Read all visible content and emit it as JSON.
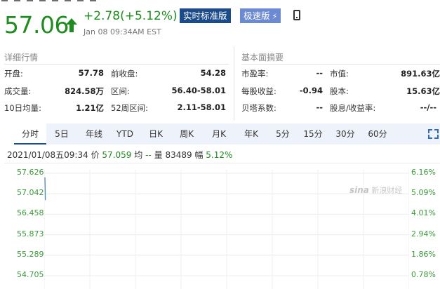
{
  "quote": {
    "price": "57.06",
    "change": "+2.78(+5.12%)",
    "timestamp": "Jan 08 09:34AM EST",
    "realtime_button": "实时标准版",
    "fast_button": "极速版",
    "fast_icon": "bolt-icon",
    "mobile_icon": "phone-icon",
    "up_color": "#1e8c1e"
  },
  "details": {
    "title": "详细行情",
    "rows": [
      [
        {
          "label": "开盘:",
          "value": "57.78"
        },
        {
          "label": "前收盘:",
          "value": "54.28"
        }
      ],
      [
        {
          "label": "成交量:",
          "value": "824.58万"
        },
        {
          "label": "区间:",
          "value": "56.40-58.01"
        }
      ],
      [
        {
          "label": "10日均量:",
          "value": "1.21亿"
        },
        {
          "label": "52周区间:",
          "value": "2.11-58.01"
        }
      ]
    ]
  },
  "fundamentals": {
    "title": "基本面摘要",
    "rows": [
      [
        {
          "label": "市盈率:",
          "value": "--"
        },
        {
          "label": "市值:",
          "value": "891.63亿"
        }
      ],
      [
        {
          "label": "每股收益:",
          "value": "-0.94"
        },
        {
          "label": "股本:",
          "value": "15.63亿"
        }
      ],
      [
        {
          "label": "贝塔系数:",
          "value": "--"
        },
        {
          "label": "股息/收益率:",
          "value": "--/--"
        }
      ]
    ]
  },
  "tabs": [
    "分时",
    "5日",
    "年线",
    "YTD",
    "日K",
    "周K",
    "月K",
    "年K",
    "5分",
    "15分",
    "30分",
    "60分"
  ],
  "active_tab": "分时",
  "toolbar_icons": [
    "fullscreen-icon",
    "more-icon"
  ],
  "chart_info": {
    "date": "2021/01/08五09:34",
    "price_label": "价",
    "price_value": "57.059",
    "avg_label": "均",
    "avg_value": "--",
    "vol_label": "量",
    "vol_value": "83489",
    "amp_label": "幅",
    "amp_value": "5.12%"
  },
  "watermark": {
    "brand": "sina",
    "text": "新浪财经"
  },
  "chart_data": {
    "type": "line",
    "y_ticks": [
      "57.626",
      "57.042",
      "56.458",
      "55.873",
      "55.289",
      "54.705"
    ],
    "y_right_ticks": [
      "6.16%",
      "5.09%",
      "4.01%",
      "2.94%",
      "1.86%",
      "0.78%"
    ],
    "ylim": [
      54.705,
      57.626
    ],
    "series": [
      {
        "values": [
          57.51,
          57.36,
          57.15,
          56.86
        ]
      }
    ],
    "line_color": "#4a8ab8",
    "grid": true
  }
}
